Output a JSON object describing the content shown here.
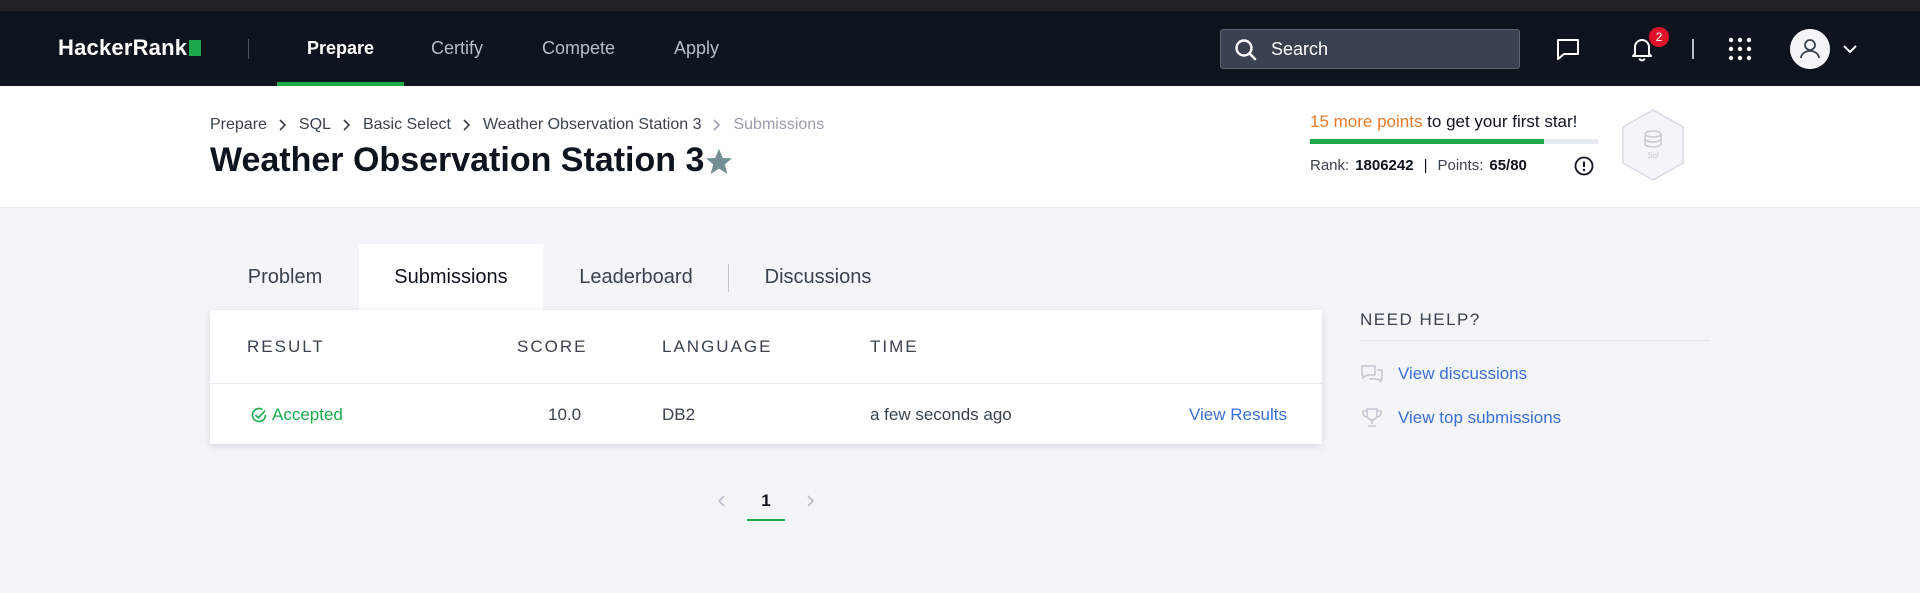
{
  "nav": {
    "logo": "HackerRank",
    "items": [
      "Prepare",
      "Certify",
      "Compete",
      "Apply"
    ],
    "active": "Prepare",
    "search_placeholder": "Search",
    "notification_count": "2"
  },
  "breadcrumb": [
    "Prepare",
    "SQL",
    "Basic Select",
    "Weather Observation Station 3",
    "Submissions"
  ],
  "challenge": {
    "title": "Weather Observation Station 3"
  },
  "progress": {
    "points_needed": "15 more points",
    "suffix": " to get your first star!",
    "fraction": 0.8125,
    "rank_label": "Rank:",
    "rank_value": "1806242",
    "points_label": "Points:",
    "points_value": "65/80",
    "badge_label": "Sql"
  },
  "tabs": [
    "Problem",
    "Submissions",
    "Leaderboard",
    "Discussions"
  ],
  "active_tab": "Submissions",
  "table": {
    "headers": [
      "Result",
      "Score",
      "Language",
      "Time"
    ],
    "rows": [
      {
        "result": "Accepted",
        "score": "10.0",
        "language": "DB2",
        "time": "a few seconds ago",
        "action": "View Results"
      }
    ]
  },
  "pagination": {
    "current": "1"
  },
  "help": {
    "title": "NEED HELP?",
    "links": [
      "View discussions",
      "View top submissions"
    ]
  },
  "colors": {
    "brand_green": "#1ba94c",
    "nav_bg": "#0e141e",
    "link_blue": "#3b6fd6",
    "points_orange": "#e97a29",
    "badge_red": "#e0112b"
  }
}
